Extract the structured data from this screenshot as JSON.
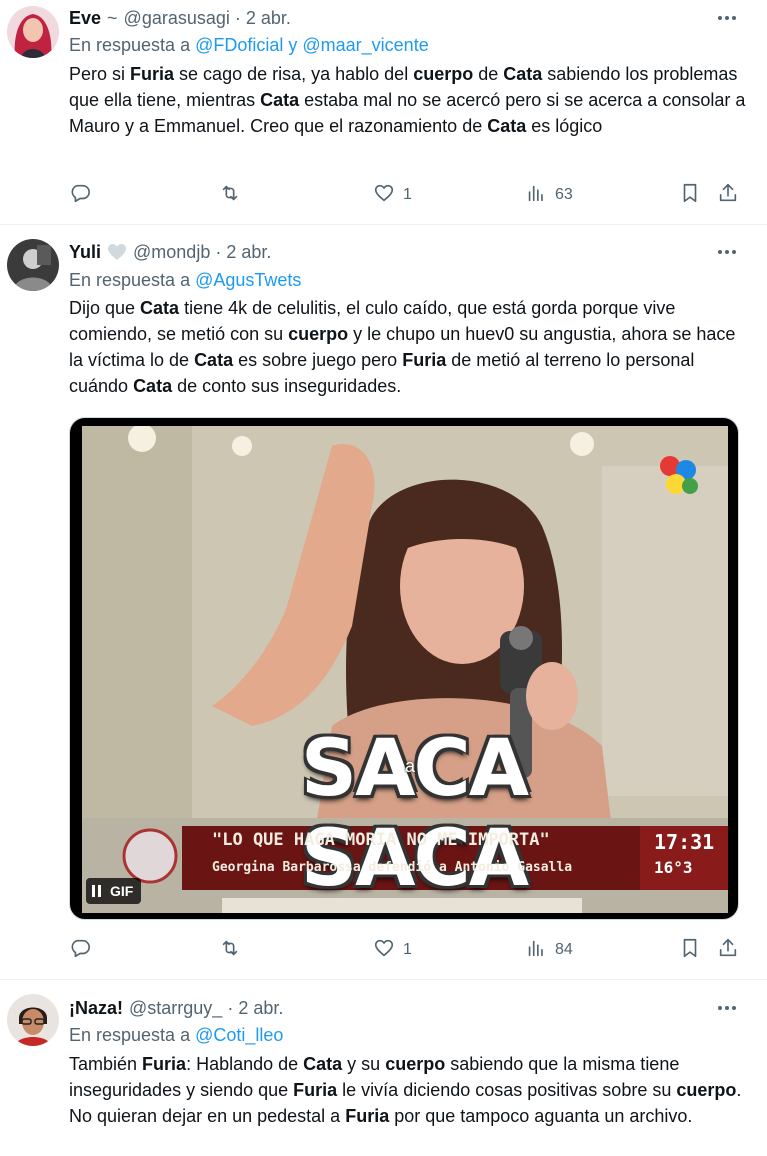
{
  "tweets": [
    {
      "name": "Eve",
      "name_suffix": "~",
      "handle": "@garasusagi",
      "date": "2 abr.",
      "reply_prefix": "En respuesta a",
      "reply_mentions": "@FDoficial y @maar_vicente",
      "body": [
        {
          "t": "Pero si "
        },
        {
          "b": "Furia"
        },
        {
          "t": " se cago de risa, ya hablo del "
        },
        {
          "b": "cuerpo"
        },
        {
          "t": " de "
        },
        {
          "b": "Cata"
        },
        {
          "t": " sabiendo los problemas que ella tiene, mientras "
        },
        {
          "b": "Cata"
        },
        {
          "t": " estaba mal no se acercó pero si se acerca a consolar a Mauro y a Emmanuel. Creo que el razonamiento de "
        },
        {
          "b": "Cata"
        },
        {
          "t": " es lógico"
        }
      ],
      "likes": "1",
      "views": "63"
    },
    {
      "name": "Yuli",
      "handle": "@mondjb",
      "date": "2 abr.",
      "reply_prefix": "En respuesta a",
      "reply_mentions": "@AgusTwets",
      "body": [
        {
          "t": "Dijo que "
        },
        {
          "b": "Cata"
        },
        {
          "t": " tiene 4k de celulitis, el culo caído, que está gorda porque vive comiendo, se metió con su "
        },
        {
          "b": "cuerpo"
        },
        {
          "t": " y le chupo un huev0 su angustia, ahora se hace la víctima lo de "
        },
        {
          "b": "Cata"
        },
        {
          "t": " es sobre juego pero "
        },
        {
          "b": "Furia"
        },
        {
          "t": " de metió al terreno lo personal cuándo "
        },
        {
          "b": "Cata"
        },
        {
          "t": " de conto sus inseguridades."
        }
      ],
      "media": {
        "overlay_title": "SACA SACA",
        "overlay_small": "a",
        "caption_line1": "\"LO QUE HAGA MORIA NO ME IMPORTA\"",
        "caption_line2": "Georgina Barbarossa defendió a Antonio Gasalla",
        "clock": "17:31",
        "temp": "16°3",
        "gif_label": "GIF"
      },
      "likes": "1",
      "views": "84"
    },
    {
      "name": "¡Naza!",
      "handle": "@starrguy_",
      "date": "2 abr.",
      "reply_prefix": "En respuesta a",
      "reply_mentions": "@Coti_lleo",
      "body": [
        {
          "t": "También "
        },
        {
          "b": "Furia"
        },
        {
          "t": ": Hablando de "
        },
        {
          "b": "Cata"
        },
        {
          "t": " y su "
        },
        {
          "b": "cuerpo"
        },
        {
          "t": " sabiendo que la misma tiene inseguridades y siendo que "
        },
        {
          "b": "Furia"
        },
        {
          "t": " le vivía diciendo cosas positivas sobre su "
        },
        {
          "b": "cuerpo"
        },
        {
          "t": ". No quieran dejar en un pedestal a "
        },
        {
          "b": "Furia"
        },
        {
          "t": " por que tampoco aguanta un archivo."
        }
      ]
    }
  ],
  "icons": {
    "reply": "reply-icon",
    "retweet": "retweet-icon",
    "like": "like-icon",
    "views": "views-icon",
    "bookmark": "bookmark-icon",
    "share": "share-icon",
    "more": "more-icon"
  },
  "colors": {
    "link": "#1d9bf0",
    "secondary_text": "#536471",
    "primary_text": "#0f1419",
    "heart_badge": "#cfd9de"
  }
}
